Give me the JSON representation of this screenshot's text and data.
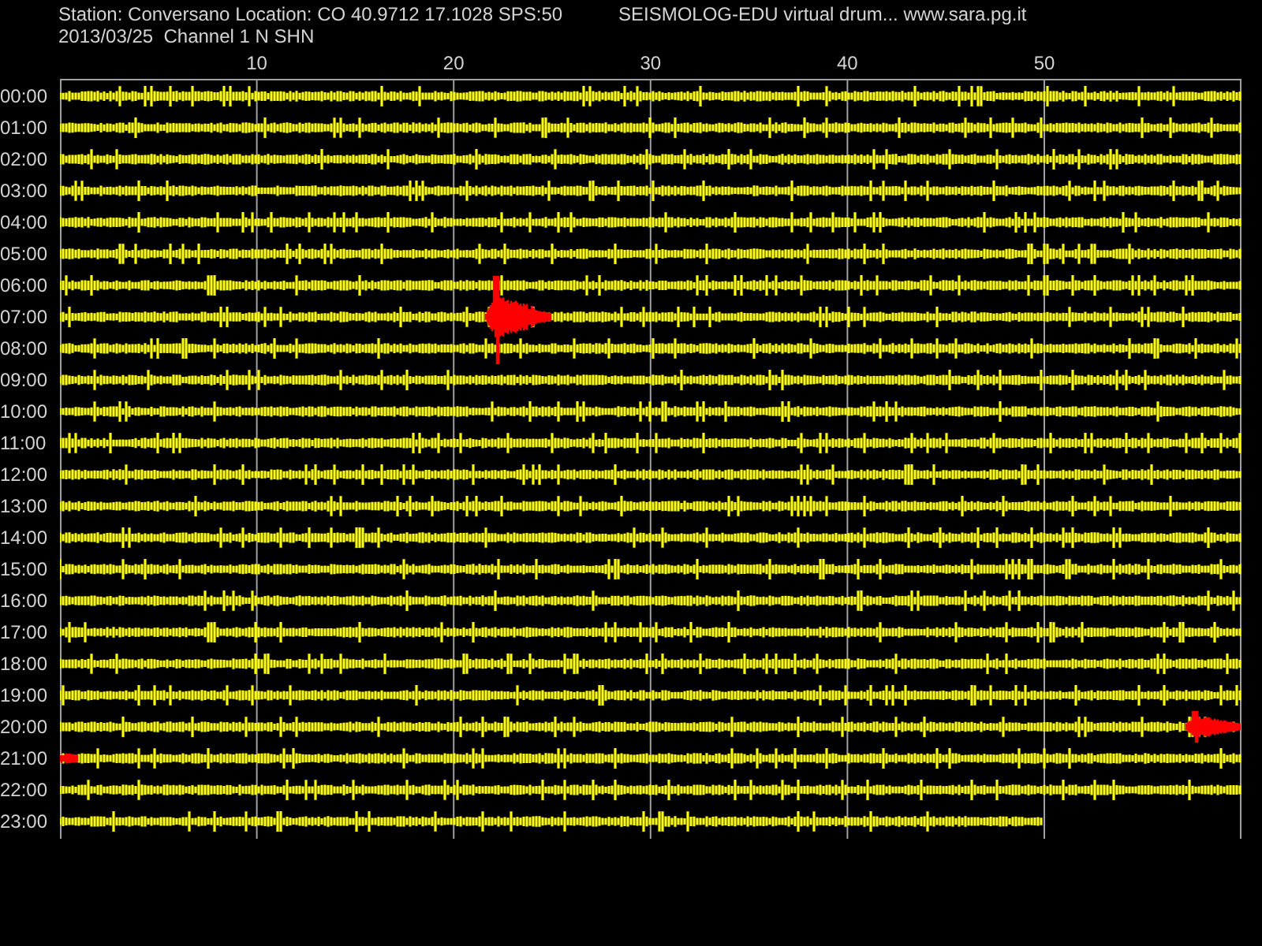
{
  "header": {
    "station": "Station: Conversano Location: CO 40.9712 17.1028 SPS:50",
    "title": "SEISMOLOG-EDU virtual drum... www.sara.pg.it",
    "date_channel": "2013/03/25  Channel 1 N SHN"
  },
  "minute_ticks": [
    "10",
    "20",
    "30",
    "40",
    "50"
  ],
  "hours": [
    {
      "label": "00:00"
    },
    {
      "label": "01:00"
    },
    {
      "label": "02:00"
    },
    {
      "label": "03:00"
    },
    {
      "label": "04:00"
    },
    {
      "label": "05:00"
    },
    {
      "label": "06:00"
    },
    {
      "label": "07:00"
    },
    {
      "label": "08:00"
    },
    {
      "label": "09:00"
    },
    {
      "label": "10:00"
    },
    {
      "label": "11:00"
    },
    {
      "label": "12:00"
    },
    {
      "label": "13:00"
    },
    {
      "label": "14:00"
    },
    {
      "label": "15:00"
    },
    {
      "label": "16:00"
    },
    {
      "label": "17:00"
    },
    {
      "label": "18:00"
    },
    {
      "label": "19:00"
    },
    {
      "label": "20:00"
    },
    {
      "label": "21:00"
    },
    {
      "label": "22:00"
    },
    {
      "label": "23:00"
    }
  ]
}
